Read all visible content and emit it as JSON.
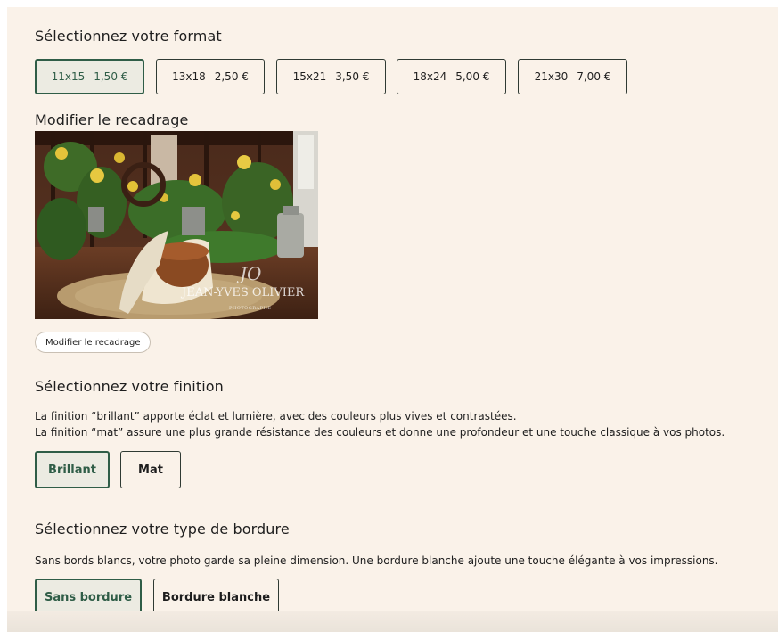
{
  "format_section": {
    "title": "Sélectionnez votre format",
    "options": [
      {
        "size": "11x15",
        "price": "1,50 €"
      },
      {
        "size": "13x18",
        "price": "2,50 €"
      },
      {
        "size": "15x21",
        "price": "3,50 €"
      },
      {
        "size": "18x24",
        "price": "5,00 €"
      },
      {
        "size": "21x30",
        "price": "7,00 €"
      }
    ],
    "selected": "11x15"
  },
  "crop_section": {
    "title": "Modifier le recadrage",
    "watermark_name": "JEAN-YVES OLIVIER",
    "watermark_sub": "PHOTOGRAPHE",
    "button_label": "Modifier le recadrage"
  },
  "finish_section": {
    "title": "Sélectionnez votre finition",
    "description_line1": "La finition “brillant” apporte éclat et lumière, avec des couleurs plus vives et contrastées.",
    "description_line2": "La finition “mat” assure une plus grande résistance des couleurs et donne une profondeur et une touche classique à vos photos.",
    "options": [
      "Brillant",
      "Mat"
    ],
    "selected": "Brillant"
  },
  "border_section": {
    "title": "Sélectionnez votre type de bordure",
    "description": "Sans bords blancs, votre photo garde sa pleine dimension. Une bordure blanche ajoute une touche élégante à vos impressions.",
    "options": [
      "Sans bordure",
      "Bordure blanche"
    ],
    "selected": "Sans bordure"
  },
  "colors": {
    "background": "#faf2e9",
    "accent": "#2f5d47",
    "selected_fill": "#ecebe2"
  }
}
